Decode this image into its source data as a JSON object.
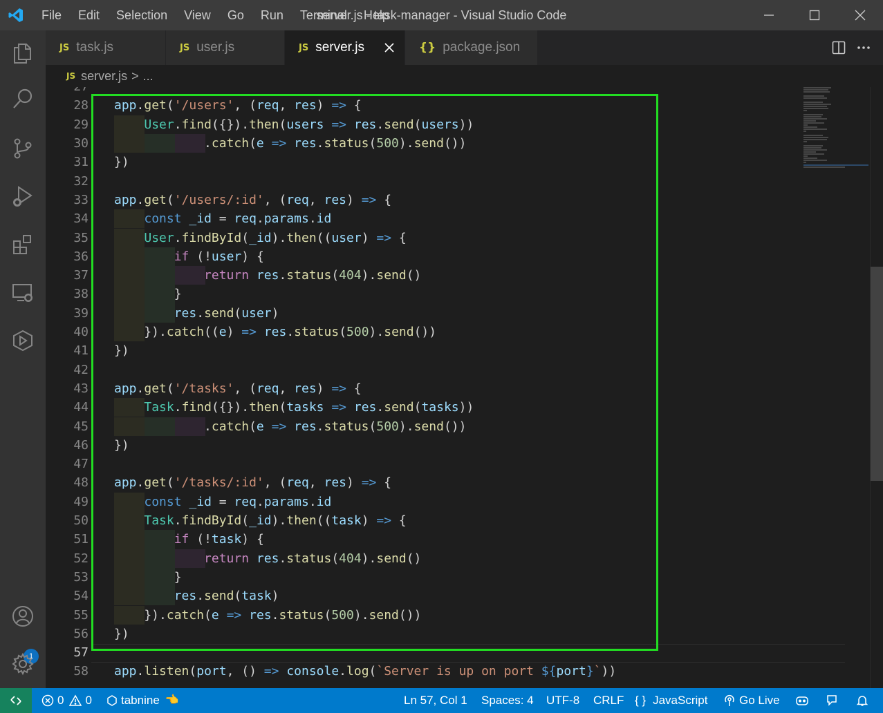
{
  "window": {
    "title": "server.js - task-manager - Visual Studio Code",
    "menu": [
      "File",
      "Edit",
      "Selection",
      "View",
      "Go",
      "Run",
      "Terminal",
      "Help"
    ]
  },
  "activity_bar": {
    "items": [
      "explorer-icon",
      "search-icon",
      "source-control-icon",
      "run-debug-icon",
      "extensions-icon",
      "remote-explorer-icon",
      "live-share-icon"
    ],
    "account_badge": "1"
  },
  "tabs": [
    {
      "icon": "JS",
      "label": "task.js",
      "active": false
    },
    {
      "icon": "JS",
      "label": "user.js",
      "active": false
    },
    {
      "icon": "JS",
      "label": "server.js",
      "active": true
    },
    {
      "icon": "{}",
      "label": "package.json",
      "active": false
    }
  ],
  "breadcrumb": {
    "icon": "JS",
    "file": "server.js",
    "separator": ">",
    "rest": "..."
  },
  "editor": {
    "partial_line_number": "27",
    "current_line": "57",
    "line_numbers": [
      "28",
      "29",
      "30",
      "31",
      "32",
      "33",
      "34",
      "35",
      "36",
      "37",
      "38",
      "39",
      "40",
      "41",
      "42",
      "43",
      "44",
      "45",
      "46",
      "47",
      "48",
      "49",
      "50",
      "51",
      "52",
      "53",
      "54",
      "55",
      "56",
      "57",
      "58"
    ]
  },
  "statusbar": {
    "errors": "0",
    "warnings": "0",
    "tabnine": "tabnine",
    "position": "Ln 57, Col 1",
    "spaces": "Spaces: 4",
    "encoding": "UTF-8",
    "eol": "CRLF",
    "language": "JavaScript",
    "golive": "Go Live"
  },
  "colors": {
    "accent_highlight": "#22dd22",
    "statusbar": "#007acc",
    "remote": "#16825d"
  }
}
